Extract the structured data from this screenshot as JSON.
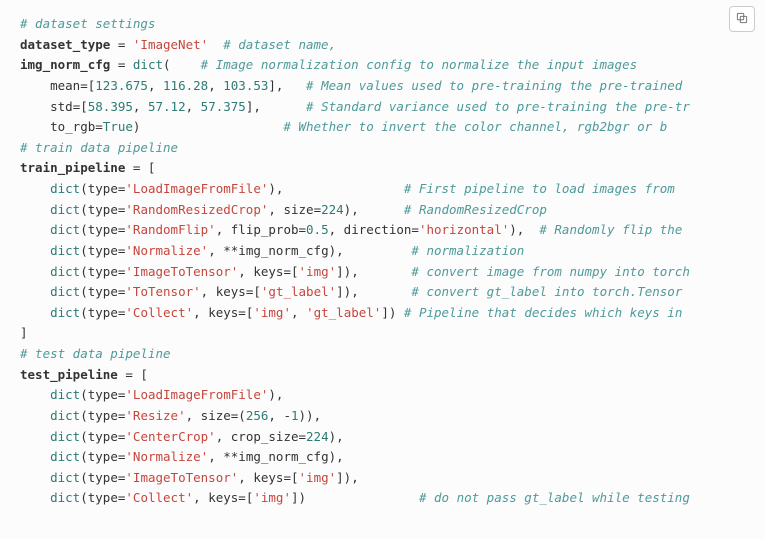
{
  "copy_button": {
    "label": "copy"
  },
  "code": {
    "lines": [
      {
        "cls": "c-comment",
        "text": "# dataset settings"
      },
      {
        "segs": [
          {
            "cls": "c-ident",
            "text": "dataset_type"
          },
          {
            "cls": "c-punct",
            "text": " = "
          },
          {
            "cls": "c-str",
            "text": "'ImageNet'"
          },
          {
            "cls": "c-punct",
            "text": "  "
          },
          {
            "cls": "c-comment",
            "text": "# dataset name,"
          }
        ]
      },
      {
        "segs": [
          {
            "cls": "c-ident",
            "text": "img_norm_cfg"
          },
          {
            "cls": "c-punct",
            "text": " = "
          },
          {
            "cls": "c-builtin",
            "text": "dict"
          },
          {
            "cls": "c-punct",
            "text": "(    "
          },
          {
            "cls": "c-comment",
            "text": "# Image normalization config to normalize the input images"
          }
        ]
      },
      {
        "segs": [
          {
            "cls": "c-punct",
            "text": "    "
          },
          {
            "cls": "c-param",
            "text": "mean"
          },
          {
            "cls": "c-punct",
            "text": "=["
          },
          {
            "cls": "c-num",
            "text": "123.675"
          },
          {
            "cls": "c-punct",
            "text": ", "
          },
          {
            "cls": "c-num",
            "text": "116.28"
          },
          {
            "cls": "c-punct",
            "text": ", "
          },
          {
            "cls": "c-num",
            "text": "103.53"
          },
          {
            "cls": "c-punct",
            "text": "],   "
          },
          {
            "cls": "c-comment",
            "text": "# Mean values used to pre-training the pre-trained"
          }
        ]
      },
      {
        "segs": [
          {
            "cls": "c-punct",
            "text": "    "
          },
          {
            "cls": "c-param",
            "text": "std"
          },
          {
            "cls": "c-punct",
            "text": "=["
          },
          {
            "cls": "c-num",
            "text": "58.395"
          },
          {
            "cls": "c-punct",
            "text": ", "
          },
          {
            "cls": "c-num",
            "text": "57.12"
          },
          {
            "cls": "c-punct",
            "text": ", "
          },
          {
            "cls": "c-num",
            "text": "57.375"
          },
          {
            "cls": "c-punct",
            "text": "],      "
          },
          {
            "cls": "c-comment",
            "text": "# Standard variance used to pre-training the pre-tr"
          }
        ]
      },
      {
        "segs": [
          {
            "cls": "c-punct",
            "text": "    "
          },
          {
            "cls": "c-param",
            "text": "to_rgb"
          },
          {
            "cls": "c-punct",
            "text": "="
          },
          {
            "cls": "c-bool",
            "text": "True"
          },
          {
            "cls": "c-punct",
            "text": ")                   "
          },
          {
            "cls": "c-comment",
            "text": "# Whether to invert the color channel, rgb2bgr or b"
          }
        ]
      },
      {
        "cls": "c-comment",
        "text": "# train data pipeline"
      },
      {
        "segs": [
          {
            "cls": "c-ident",
            "text": "train_pipeline"
          },
          {
            "cls": "c-punct",
            "text": " = ["
          }
        ]
      },
      {
        "segs": [
          {
            "cls": "c-punct",
            "text": "    "
          },
          {
            "cls": "c-builtin",
            "text": "dict"
          },
          {
            "cls": "c-punct",
            "text": "("
          },
          {
            "cls": "c-param",
            "text": "type"
          },
          {
            "cls": "c-punct",
            "text": "="
          },
          {
            "cls": "c-str",
            "text": "'LoadImageFromFile'"
          },
          {
            "cls": "c-punct",
            "text": "),                "
          },
          {
            "cls": "c-comment",
            "text": "# First pipeline to load images from"
          }
        ]
      },
      {
        "segs": [
          {
            "cls": "c-punct",
            "text": "    "
          },
          {
            "cls": "c-builtin",
            "text": "dict"
          },
          {
            "cls": "c-punct",
            "text": "("
          },
          {
            "cls": "c-param",
            "text": "type"
          },
          {
            "cls": "c-punct",
            "text": "="
          },
          {
            "cls": "c-str",
            "text": "'RandomResizedCrop'"
          },
          {
            "cls": "c-punct",
            "text": ", "
          },
          {
            "cls": "c-param",
            "text": "size"
          },
          {
            "cls": "c-punct",
            "text": "="
          },
          {
            "cls": "c-num",
            "text": "224"
          },
          {
            "cls": "c-punct",
            "text": "),      "
          },
          {
            "cls": "c-comment",
            "text": "# RandomResizedCrop"
          }
        ]
      },
      {
        "segs": [
          {
            "cls": "c-punct",
            "text": "    "
          },
          {
            "cls": "c-builtin",
            "text": "dict"
          },
          {
            "cls": "c-punct",
            "text": "("
          },
          {
            "cls": "c-param",
            "text": "type"
          },
          {
            "cls": "c-punct",
            "text": "="
          },
          {
            "cls": "c-str",
            "text": "'RandomFlip'"
          },
          {
            "cls": "c-punct",
            "text": ", "
          },
          {
            "cls": "c-param",
            "text": "flip_prob"
          },
          {
            "cls": "c-punct",
            "text": "="
          },
          {
            "cls": "c-num",
            "text": "0.5"
          },
          {
            "cls": "c-punct",
            "text": ", "
          },
          {
            "cls": "c-param",
            "text": "direction"
          },
          {
            "cls": "c-punct",
            "text": "="
          },
          {
            "cls": "c-str",
            "text": "'horizontal'"
          },
          {
            "cls": "c-punct",
            "text": "),  "
          },
          {
            "cls": "c-comment",
            "text": "# Randomly flip the"
          }
        ]
      },
      {
        "segs": [
          {
            "cls": "c-punct",
            "text": "    "
          },
          {
            "cls": "c-builtin",
            "text": "dict"
          },
          {
            "cls": "c-punct",
            "text": "("
          },
          {
            "cls": "c-param",
            "text": "type"
          },
          {
            "cls": "c-punct",
            "text": "="
          },
          {
            "cls": "c-str",
            "text": "'Normalize'"
          },
          {
            "cls": "c-punct",
            "text": ", **"
          },
          {
            "cls": "c-param",
            "text": "img_norm_cfg"
          },
          {
            "cls": "c-punct",
            "text": "),         "
          },
          {
            "cls": "c-comment",
            "text": "# normalization"
          }
        ]
      },
      {
        "segs": [
          {
            "cls": "c-punct",
            "text": "    "
          },
          {
            "cls": "c-builtin",
            "text": "dict"
          },
          {
            "cls": "c-punct",
            "text": "("
          },
          {
            "cls": "c-param",
            "text": "type"
          },
          {
            "cls": "c-punct",
            "text": "="
          },
          {
            "cls": "c-str",
            "text": "'ImageToTensor'"
          },
          {
            "cls": "c-punct",
            "text": ", "
          },
          {
            "cls": "c-param",
            "text": "keys"
          },
          {
            "cls": "c-punct",
            "text": "=["
          },
          {
            "cls": "c-str",
            "text": "'img'"
          },
          {
            "cls": "c-punct",
            "text": "]),       "
          },
          {
            "cls": "c-comment",
            "text": "# convert image from numpy into torch"
          }
        ]
      },
      {
        "segs": [
          {
            "cls": "c-punct",
            "text": "    "
          },
          {
            "cls": "c-builtin",
            "text": "dict"
          },
          {
            "cls": "c-punct",
            "text": "("
          },
          {
            "cls": "c-param",
            "text": "type"
          },
          {
            "cls": "c-punct",
            "text": "="
          },
          {
            "cls": "c-str",
            "text": "'ToTensor'"
          },
          {
            "cls": "c-punct",
            "text": ", "
          },
          {
            "cls": "c-param",
            "text": "keys"
          },
          {
            "cls": "c-punct",
            "text": "=["
          },
          {
            "cls": "c-str",
            "text": "'gt_label'"
          },
          {
            "cls": "c-punct",
            "text": "]),       "
          },
          {
            "cls": "c-comment",
            "text": "# convert gt_label into torch.Tensor"
          }
        ]
      },
      {
        "segs": [
          {
            "cls": "c-punct",
            "text": "    "
          },
          {
            "cls": "c-builtin",
            "text": "dict"
          },
          {
            "cls": "c-punct",
            "text": "("
          },
          {
            "cls": "c-param",
            "text": "type"
          },
          {
            "cls": "c-punct",
            "text": "="
          },
          {
            "cls": "c-str",
            "text": "'Collect'"
          },
          {
            "cls": "c-punct",
            "text": ", "
          },
          {
            "cls": "c-param",
            "text": "keys"
          },
          {
            "cls": "c-punct",
            "text": "=["
          },
          {
            "cls": "c-str",
            "text": "'img'"
          },
          {
            "cls": "c-punct",
            "text": ", "
          },
          {
            "cls": "c-str",
            "text": "'gt_label'"
          },
          {
            "cls": "c-punct",
            "text": "]) "
          },
          {
            "cls": "c-comment",
            "text": "# Pipeline that decides which keys in"
          }
        ]
      },
      {
        "segs": [
          {
            "cls": "c-punct",
            "text": "]"
          }
        ]
      },
      {
        "cls": "c-comment",
        "text": "# test data pipeline"
      },
      {
        "segs": [
          {
            "cls": "c-ident",
            "text": "test_pipeline"
          },
          {
            "cls": "c-punct",
            "text": " = ["
          }
        ]
      },
      {
        "segs": [
          {
            "cls": "c-punct",
            "text": "    "
          },
          {
            "cls": "c-builtin",
            "text": "dict"
          },
          {
            "cls": "c-punct",
            "text": "("
          },
          {
            "cls": "c-param",
            "text": "type"
          },
          {
            "cls": "c-punct",
            "text": "="
          },
          {
            "cls": "c-str",
            "text": "'LoadImageFromFile'"
          },
          {
            "cls": "c-punct",
            "text": "),"
          }
        ]
      },
      {
        "segs": [
          {
            "cls": "c-punct",
            "text": "    "
          },
          {
            "cls": "c-builtin",
            "text": "dict"
          },
          {
            "cls": "c-punct",
            "text": "("
          },
          {
            "cls": "c-param",
            "text": "type"
          },
          {
            "cls": "c-punct",
            "text": "="
          },
          {
            "cls": "c-str",
            "text": "'Resize'"
          },
          {
            "cls": "c-punct",
            "text": ", "
          },
          {
            "cls": "c-param",
            "text": "size"
          },
          {
            "cls": "c-punct",
            "text": "=("
          },
          {
            "cls": "c-num",
            "text": "256"
          },
          {
            "cls": "c-punct",
            "text": ", -"
          },
          {
            "cls": "c-num",
            "text": "1"
          },
          {
            "cls": "c-punct",
            "text": ")),"
          }
        ]
      },
      {
        "segs": [
          {
            "cls": "c-punct",
            "text": "    "
          },
          {
            "cls": "c-builtin",
            "text": "dict"
          },
          {
            "cls": "c-punct",
            "text": "("
          },
          {
            "cls": "c-param",
            "text": "type"
          },
          {
            "cls": "c-punct",
            "text": "="
          },
          {
            "cls": "c-str",
            "text": "'CenterCrop'"
          },
          {
            "cls": "c-punct",
            "text": ", "
          },
          {
            "cls": "c-param",
            "text": "crop_size"
          },
          {
            "cls": "c-punct",
            "text": "="
          },
          {
            "cls": "c-num",
            "text": "224"
          },
          {
            "cls": "c-punct",
            "text": "),"
          }
        ]
      },
      {
        "segs": [
          {
            "cls": "c-punct",
            "text": "    "
          },
          {
            "cls": "c-builtin",
            "text": "dict"
          },
          {
            "cls": "c-punct",
            "text": "("
          },
          {
            "cls": "c-param",
            "text": "type"
          },
          {
            "cls": "c-punct",
            "text": "="
          },
          {
            "cls": "c-str",
            "text": "'Normalize'"
          },
          {
            "cls": "c-punct",
            "text": ", **"
          },
          {
            "cls": "c-param",
            "text": "img_norm_cfg"
          },
          {
            "cls": "c-punct",
            "text": "),"
          }
        ]
      },
      {
        "segs": [
          {
            "cls": "c-punct",
            "text": "    "
          },
          {
            "cls": "c-builtin",
            "text": "dict"
          },
          {
            "cls": "c-punct",
            "text": "("
          },
          {
            "cls": "c-param",
            "text": "type"
          },
          {
            "cls": "c-punct",
            "text": "="
          },
          {
            "cls": "c-str",
            "text": "'ImageToTensor'"
          },
          {
            "cls": "c-punct",
            "text": ", "
          },
          {
            "cls": "c-param",
            "text": "keys"
          },
          {
            "cls": "c-punct",
            "text": "=["
          },
          {
            "cls": "c-str",
            "text": "'img'"
          },
          {
            "cls": "c-punct",
            "text": "]),"
          }
        ]
      },
      {
        "segs": [
          {
            "cls": "c-punct",
            "text": "    "
          },
          {
            "cls": "c-builtin",
            "text": "dict"
          },
          {
            "cls": "c-punct",
            "text": "("
          },
          {
            "cls": "c-param",
            "text": "type"
          },
          {
            "cls": "c-punct",
            "text": "="
          },
          {
            "cls": "c-str",
            "text": "'Collect'"
          },
          {
            "cls": "c-punct",
            "text": ", "
          },
          {
            "cls": "c-param",
            "text": "keys"
          },
          {
            "cls": "c-punct",
            "text": "=["
          },
          {
            "cls": "c-str",
            "text": "'img'"
          },
          {
            "cls": "c-punct",
            "text": "])               "
          },
          {
            "cls": "c-comment",
            "text": "# do not pass gt_label while testing"
          }
        ]
      }
    ]
  }
}
